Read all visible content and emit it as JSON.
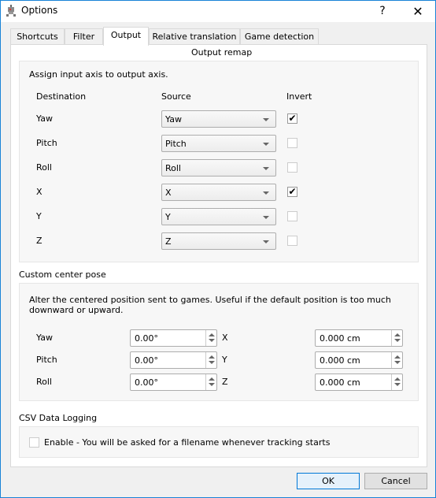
{
  "window": {
    "title": "Options",
    "help_label": "?",
    "close_label": "✕",
    "app_icon": "tracker-icon"
  },
  "tabs": [
    {
      "label": "Shortcuts",
      "active": false
    },
    {
      "label": "Filter",
      "active": false
    },
    {
      "label": "Output",
      "active": true
    },
    {
      "label": "Relative translation",
      "active": false
    },
    {
      "label": "Game detection",
      "active": false
    }
  ],
  "output_remap": {
    "title": "Output remap",
    "description": "Assign input axis to output axis.",
    "headers": {
      "destination": "Destination",
      "source": "Source",
      "invert": "Invert"
    },
    "rows": [
      {
        "destination": "Yaw",
        "source": "Yaw",
        "invert": true
      },
      {
        "destination": "Pitch",
        "source": "Pitch",
        "invert": false
      },
      {
        "destination": "Roll",
        "source": "Roll",
        "invert": false
      },
      {
        "destination": "X",
        "source": "X",
        "invert": true
      },
      {
        "destination": "Y",
        "source": "Y",
        "invert": false
      },
      {
        "destination": "Z",
        "source": "Z",
        "invert": false
      }
    ]
  },
  "center_pose": {
    "title": "Custom center pose",
    "description": "Alter the centered position sent to games. Useful if the default position is too much downward or upward.",
    "rotation": [
      {
        "label": "Yaw",
        "value": "0.00°"
      },
      {
        "label": "Pitch",
        "value": "0.00°"
      },
      {
        "label": "Roll",
        "value": "0.00°"
      }
    ],
    "translation": [
      {
        "label": "X",
        "value": "0.000 cm"
      },
      {
        "label": "Y",
        "value": "0.000 cm"
      },
      {
        "label": "Z",
        "value": "0.000 cm"
      }
    ]
  },
  "csv_logging": {
    "title": "CSV Data Logging",
    "enable_label": "Enable - You will be asked for a filename whenever tracking starts",
    "enabled": false
  },
  "buttons": {
    "ok": "OK",
    "cancel": "Cancel"
  },
  "check_glyph": "✔"
}
